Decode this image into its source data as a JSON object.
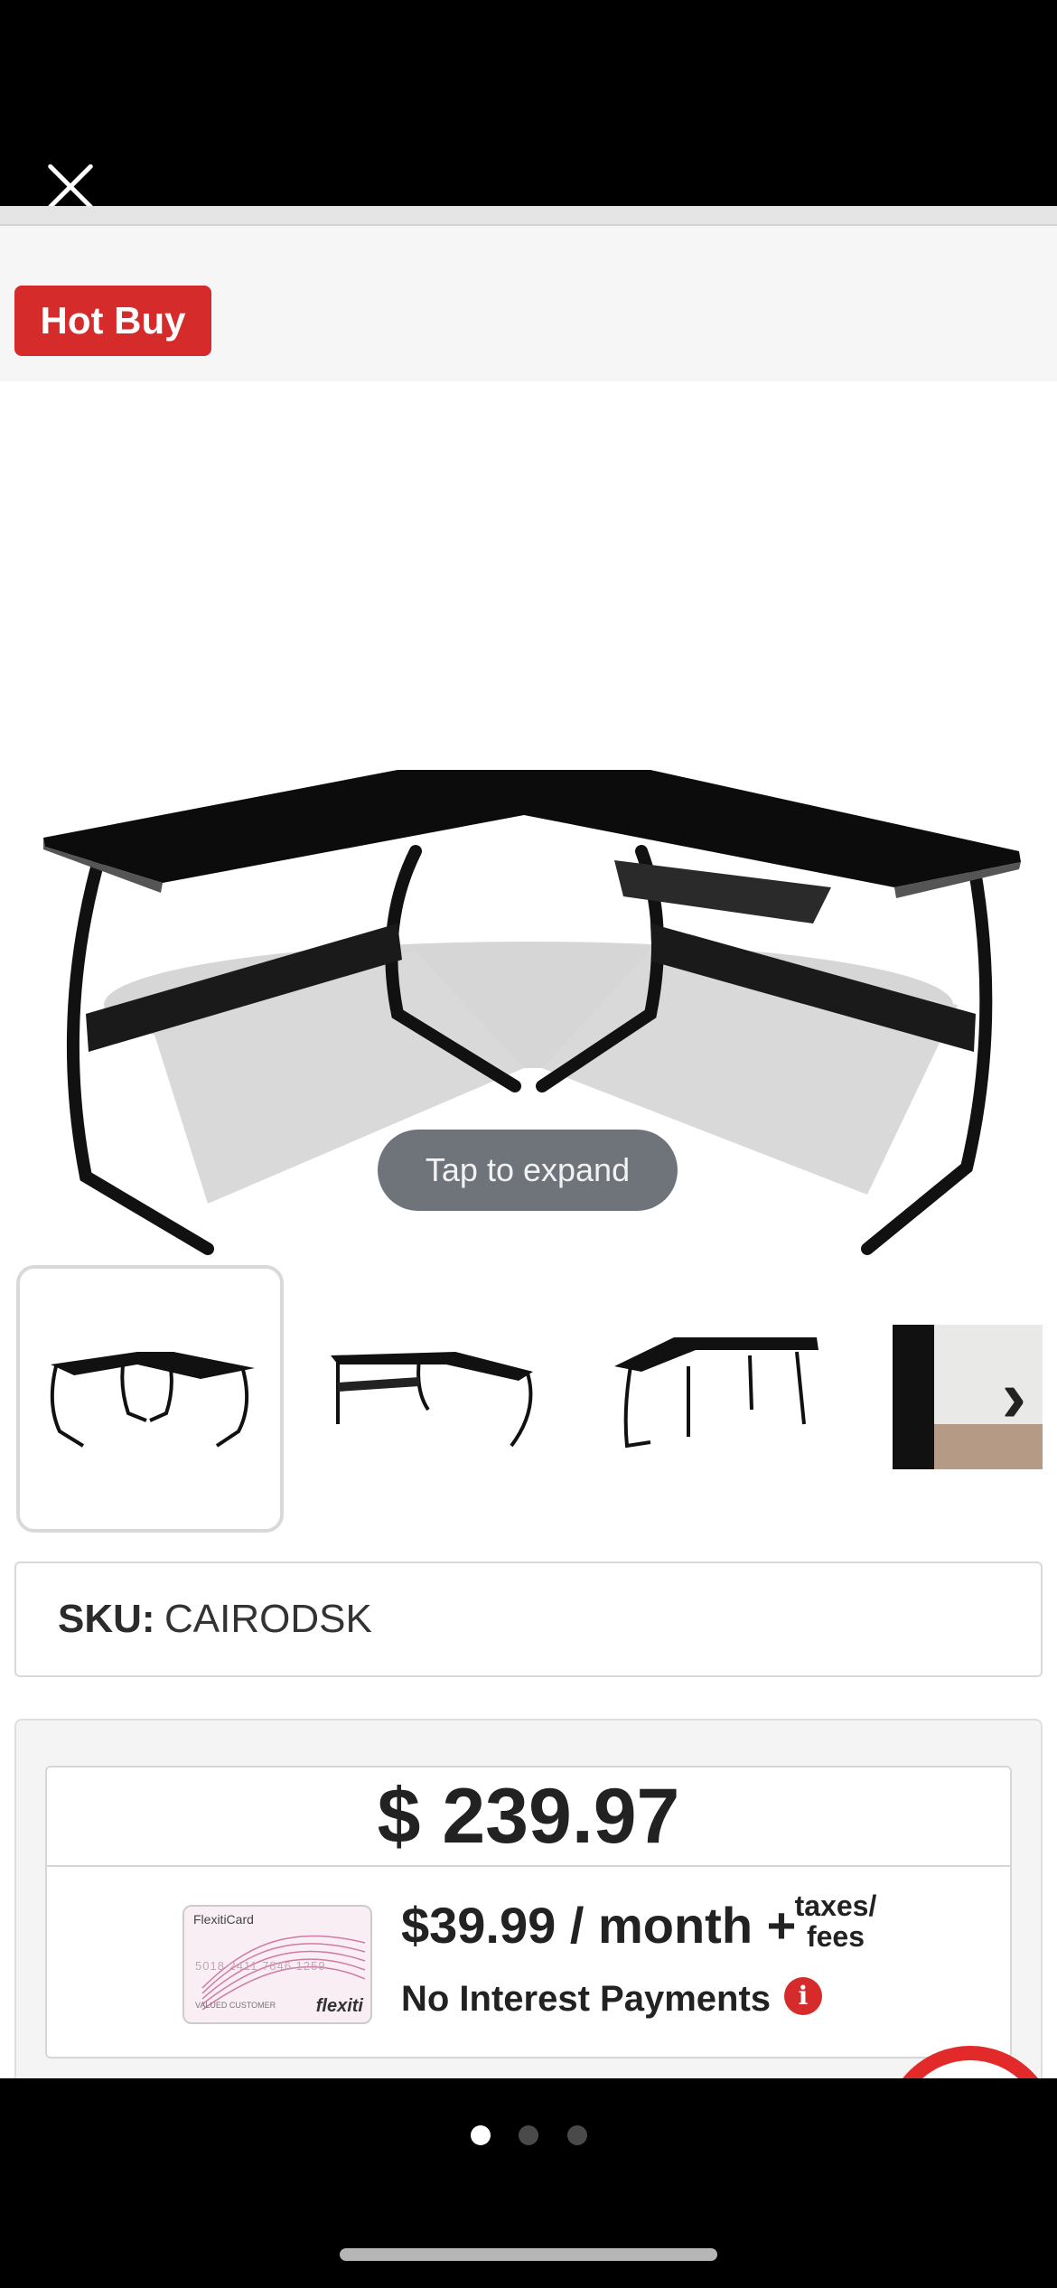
{
  "header": {
    "close_icon": "close-icon"
  },
  "badge": {
    "label": "Hot Buy",
    "color": "#d52b2b"
  },
  "gallery": {
    "expand_label": "Tap to expand",
    "thumbnails": [
      "thumbnail-1",
      "thumbnail-2",
      "thumbnail-3",
      "thumbnail-4"
    ],
    "selected_index": 0,
    "next_icon": "chevron-right-icon"
  },
  "sku": {
    "label": "SKU:",
    "value": "CAIRODSK"
  },
  "pricing": {
    "price": "$ 239.97",
    "monthly": "$39.99 / month +",
    "fees_line1": "taxes/",
    "fees_line2": "fees",
    "no_interest": "No Interest Payments",
    "info_icon": "i"
  },
  "flexiti_card": {
    "title": "FlexitiCard",
    "number": "5018 2411 7846 1259",
    "holder": "VALUED CUSTOMER",
    "brand": "flexiti"
  },
  "pager": {
    "dots": 3,
    "active": 0
  },
  "colors": {
    "accent": "#d52b2b",
    "background": "#000000"
  }
}
